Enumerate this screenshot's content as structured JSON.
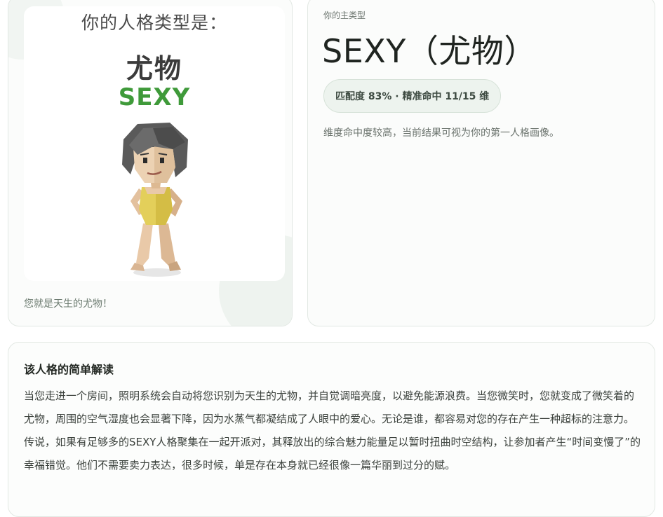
{
  "poster": {
    "heading": "你的人格类型是：",
    "name_cn": "尤物",
    "name_en": "SEXY",
    "caption": "您就是天生的尤物！"
  },
  "result": {
    "label": "你的主类型",
    "title": "SEXY（尤物）",
    "match_badge": "匹配度 83% · 精准命中 11/15 维",
    "description": "维度命中度较高，当前结果可视为你的第一人格画像。"
  },
  "interpretation": {
    "title": "该人格的简单解读",
    "body": "当您走进一个房间，照明系统会自动将您识别为天生的尤物，并自觉调暗亮度，以避免能源浪费。当您微笑时，您就变成了微笑着的尤物，周围的空气湿度也会显著下降，因为水蒸气都凝结成了人眼中的爱心。无论是谁，都容易对您的存在产生一种超标的注意力。传说，如果有足够多的SEXY人格聚集在一起开派对，其释放出的综合魅力能量足以暂时扭曲时空结构，让参加者产生“时间变慢了”的幸福错觉。他们不需要卖力表达，很多时候，单是存在本身就已经很像一篇华丽到过分的赋。"
  },
  "colors": {
    "accent_green": "#3f9a3a",
    "badge_bg": "#edf3ee"
  }
}
